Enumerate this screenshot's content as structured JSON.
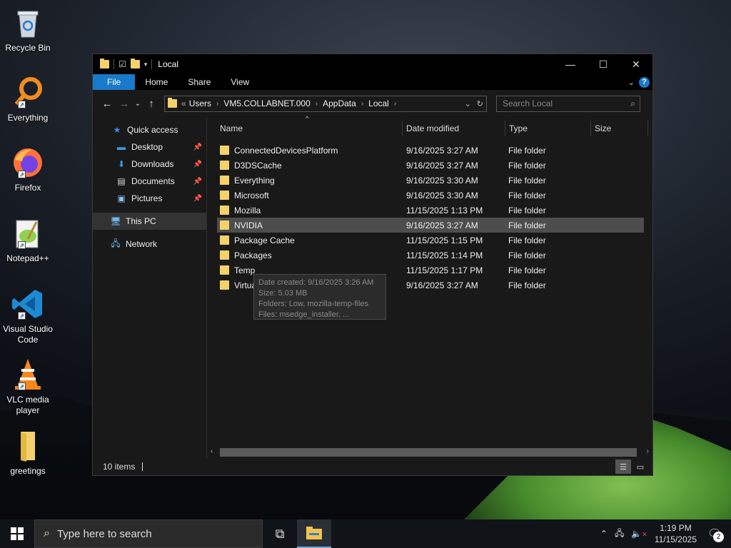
{
  "desktop": {
    "icons": [
      {
        "label": "Recycle Bin"
      },
      {
        "label": "Everything"
      },
      {
        "label": "Firefox"
      },
      {
        "label": "Notepad++"
      },
      {
        "label": "Visual Studio Code"
      },
      {
        "label": "VLC media player"
      },
      {
        "label": "greetings"
      }
    ]
  },
  "window": {
    "title": "Local",
    "controls": {
      "minimize": "—",
      "maximize": "☐",
      "close": "✕"
    }
  },
  "ribbon": {
    "tabs": [
      "File",
      "Home",
      "Share",
      "View"
    ],
    "help": "?"
  },
  "address": {
    "prefix": "«",
    "crumbs": [
      "Users",
      "VM5.COLLABNET.000",
      "AppData",
      "Local"
    ],
    "search_placeholder": "Search Local"
  },
  "navpane": {
    "quick_access": "Quick access",
    "items": [
      {
        "label": "Desktop",
        "icon": "desktop-icon"
      },
      {
        "label": "Downloads",
        "icon": "downloads-icon"
      },
      {
        "label": "Documents",
        "icon": "documents-icon"
      },
      {
        "label": "Pictures",
        "icon": "pictures-icon"
      }
    ],
    "this_pc": "This PC",
    "network": "Network"
  },
  "columns": {
    "name": "Name",
    "date": "Date modified",
    "type": "Type",
    "size": "Size"
  },
  "files": [
    {
      "name": "ConnectedDevicesPlatform",
      "date": "9/16/2025 3:27 AM",
      "type": "File folder"
    },
    {
      "name": "D3DSCache",
      "date": "9/16/2025 3:27 AM",
      "type": "File folder"
    },
    {
      "name": "Everything",
      "date": "9/16/2025 3:30 AM",
      "type": "File folder"
    },
    {
      "name": "Microsoft",
      "date": "9/16/2025 3:30 AM",
      "type": "File folder"
    },
    {
      "name": "Mozilla",
      "date": "11/15/2025 1:13 PM",
      "type": "File folder"
    },
    {
      "name": "NVIDIA",
      "date": "9/16/2025 3:27 AM",
      "type": "File folder"
    },
    {
      "name": "Package Cache",
      "date": "11/15/2025 1:15 PM",
      "type": "File folder"
    },
    {
      "name": "Packages",
      "date": "11/15/2025 1:14 PM",
      "type": "File folder"
    },
    {
      "name": "Temp",
      "date": "11/15/2025 1:17 PM",
      "type": "File folder"
    },
    {
      "name": "VirtualStore",
      "date": "9/16/2025 3:27 AM",
      "type": "File folder"
    }
  ],
  "tooltip": {
    "line1": "Date created: 9/16/2025 3:26 AM",
    "line2": "Size: 5.03 MB",
    "line3": "Folders: Low, mozilla-temp-files",
    "line4": "Files: msedge_installer, ..."
  },
  "status": {
    "items": "10 items"
  },
  "taskbar": {
    "search_placeholder": "Type here to search",
    "time": "1:19 PM",
    "date": "11/15/2025",
    "notifications": "2"
  }
}
